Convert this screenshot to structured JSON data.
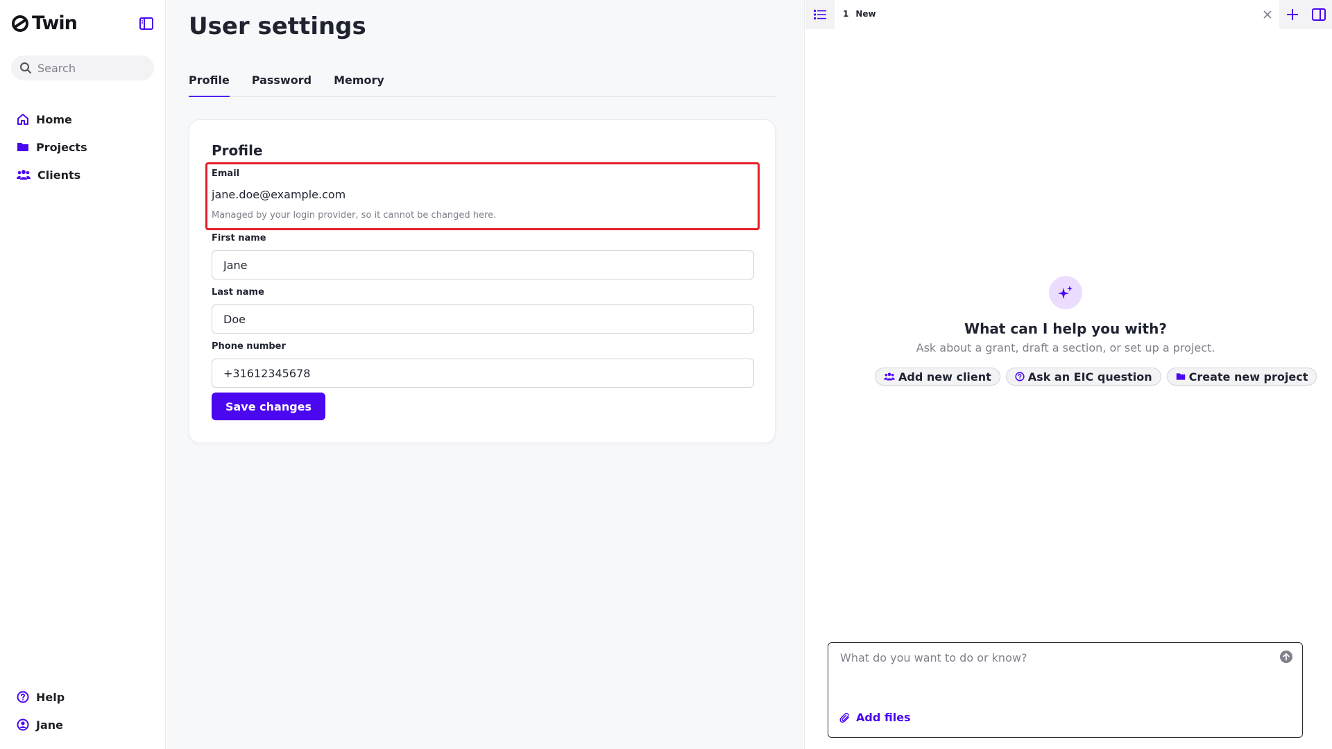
{
  "app": {
    "name": "Twin"
  },
  "sidebar": {
    "search_placeholder": "Search",
    "items": [
      {
        "label": "Home",
        "icon": "home-icon"
      },
      {
        "label": "Projects",
        "icon": "folder-icon"
      },
      {
        "label": "Clients",
        "icon": "users-icon"
      }
    ],
    "bottom_items": [
      {
        "label": "Help",
        "icon": "help-circle-icon"
      },
      {
        "label": "Jane",
        "icon": "user-circle-icon"
      }
    ]
  },
  "main": {
    "title": "User settings",
    "tabs": [
      {
        "label": "Profile",
        "active": true
      },
      {
        "label": "Password",
        "active": false
      },
      {
        "label": "Memory",
        "active": false
      }
    ],
    "profile": {
      "heading": "Profile",
      "email_label": "Email",
      "email_value": "jane.doe@example.com",
      "email_help": "Managed by your login provider, so it cannot be changed here.",
      "first_name_label": "First name",
      "first_name_value": "Jane",
      "last_name_label": "Last name",
      "last_name_value": "Doe",
      "phone_label": "Phone number",
      "phone_value": "+31612345678",
      "save_label": "Save changes"
    }
  },
  "chat": {
    "tab_number": "1",
    "tab_label": "New",
    "help_title": "What can I help you with?",
    "help_subtitle": "Ask about a grant, draft a section, or set up a project.",
    "suggestions": [
      {
        "label": "Add new client",
        "icon": "users-icon"
      },
      {
        "label": "Ask an EIC question",
        "icon": "help-circle-icon"
      },
      {
        "label": "Create new project",
        "icon": "folder-icon"
      }
    ],
    "composer_placeholder": "What do you want to do or know?",
    "add_files_label": "Add files"
  },
  "colors": {
    "accent": "#4a07f0",
    "highlight_border": "#e61e2a",
    "sparkle_bg": "#ecdcfe"
  }
}
